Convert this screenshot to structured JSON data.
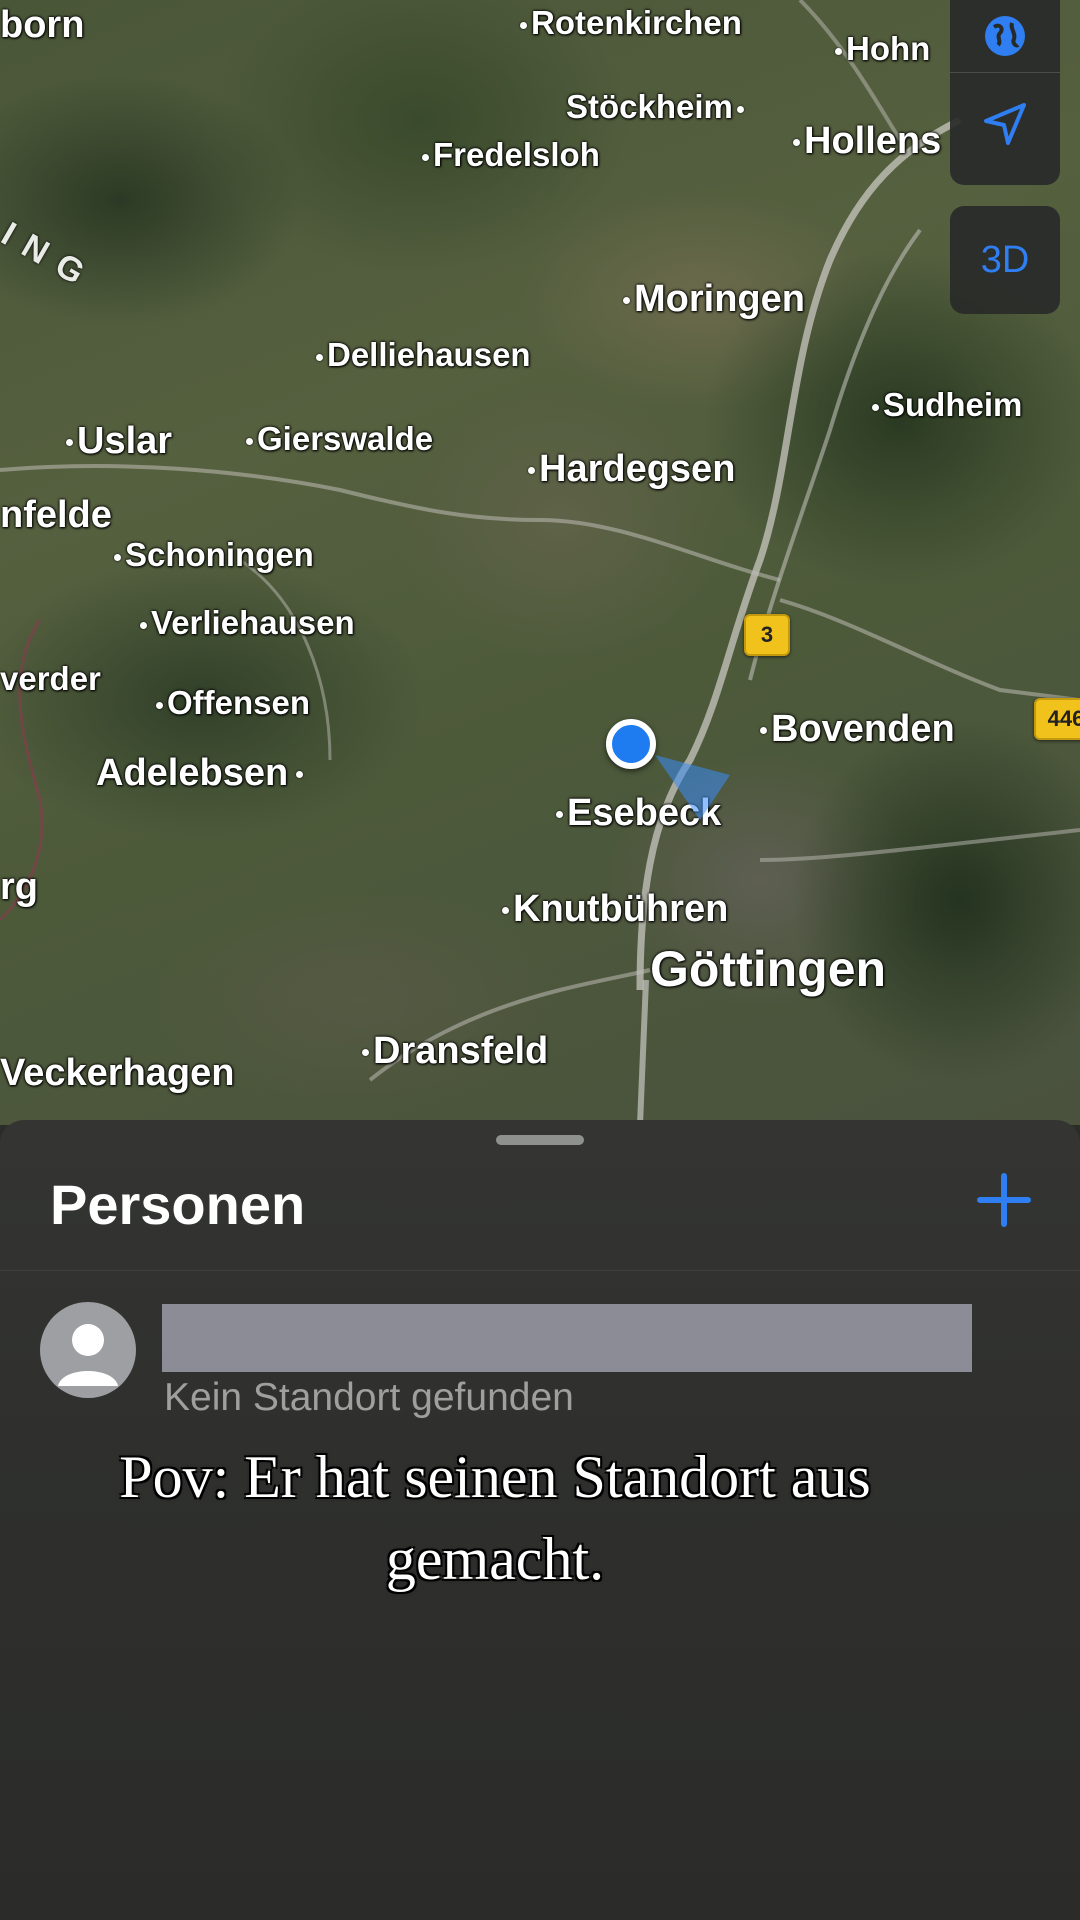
{
  "map": {
    "places": [
      {
        "id": "born",
        "name": "born",
        "size": "m"
      },
      {
        "id": "rotenkirchen",
        "name": "Rotenkirchen",
        "size": "s"
      },
      {
        "id": "hohn",
        "name": "Hohn",
        "size": "s"
      },
      {
        "id": "stoeckheim",
        "name": "Stöckheim",
        "size": "s"
      },
      {
        "id": "fredelsloh",
        "name": "Fredelsloh",
        "size": "s"
      },
      {
        "id": "hollens",
        "name": "Hollens",
        "size": "m"
      },
      {
        "id": "moringen",
        "name": "Moringen",
        "size": "m"
      },
      {
        "id": "delliehausen",
        "name": "Delliehausen",
        "size": "s"
      },
      {
        "id": "sudheim",
        "name": "Sudheim",
        "size": "s"
      },
      {
        "id": "uslar",
        "name": "Uslar",
        "size": "m"
      },
      {
        "id": "gierswalde",
        "name": "Gierswalde",
        "size": "s"
      },
      {
        "id": "hardegsen",
        "name": "Hardegsen",
        "size": "m"
      },
      {
        "id": "nfelde",
        "name": "nfelde",
        "size": "m"
      },
      {
        "id": "schoningen",
        "name": "Schoningen",
        "size": "s"
      },
      {
        "id": "verliehausen",
        "name": "Verliehausen",
        "size": "s"
      },
      {
        "id": "verder",
        "name": "verder",
        "size": "s"
      },
      {
        "id": "offensen",
        "name": "Offensen",
        "size": "s"
      },
      {
        "id": "bovenden",
        "name": "Bovenden",
        "size": "m"
      },
      {
        "id": "adelebsen",
        "name": "Adelebsen",
        "size": "m"
      },
      {
        "id": "esebeck",
        "name": "Esebeck",
        "size": "m"
      },
      {
        "id": "rg",
        "name": "rg",
        "size": "m"
      },
      {
        "id": "knutbuehren",
        "name": "Knutbühren",
        "size": "m"
      },
      {
        "id": "goettingen",
        "name": "Göttingen",
        "size": "l"
      },
      {
        "id": "dransfeld",
        "name": "Dransfeld",
        "size": "m"
      },
      {
        "id": "veckerhagen",
        "name": "Veckerhagen",
        "size": "m"
      }
    ],
    "region_label": "ING",
    "road_shields": [
      {
        "id": "road-3",
        "label": "3"
      },
      {
        "id": "road-446",
        "label": "446"
      }
    ],
    "controls": {
      "globe_icon": "globe-icon",
      "location_icon": "location-arrow-icon",
      "mode_3d_label": "3D"
    },
    "colors": {
      "accent": "#2f7ef2",
      "location_dot": "#1e7cf0",
      "shield": "#f1c21b"
    }
  },
  "sheet": {
    "title": "Personen",
    "add_icon": "plus-icon",
    "people": [
      {
        "name": "",
        "status": "Kein Standort gefunden",
        "avatar_icon": "person-avatar-icon"
      }
    ]
  },
  "caption": "Pov: Er hat seinen Standort aus gemacht."
}
